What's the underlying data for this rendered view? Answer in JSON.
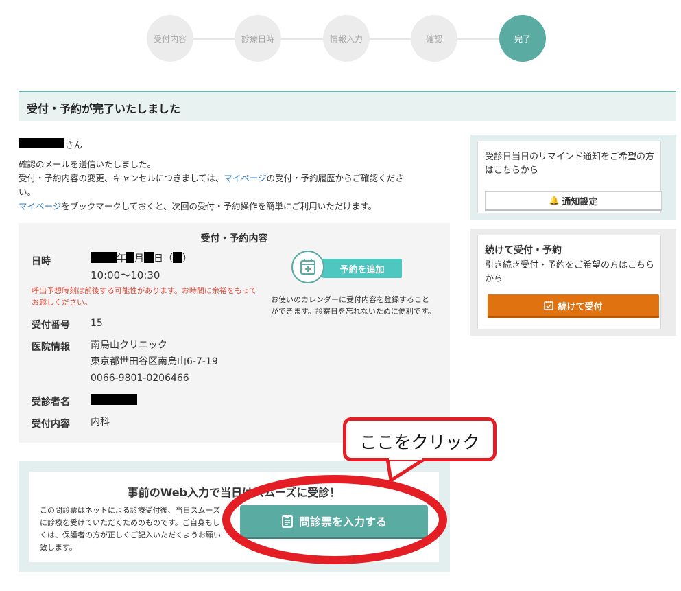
{
  "stepper": {
    "steps": [
      "受付内容",
      "診療日時",
      "情報入力",
      "確認",
      "完了"
    ]
  },
  "page_title": "受付・予約が完了いたしました",
  "intro": {
    "name_suffix": "さん",
    "line1": "確認のメールを送信いたしました。",
    "line2_a": "受付・予約内容の変更、キャンセルにつきましては、",
    "mypage_link": "マイページ",
    "line2_b": "の受付・予約履歴からご確認くださ",
    "line3": "い。",
    "line4_b": "をブックマークしておくと、次回の受付・予約操作を簡単にご利用いただけます。"
  },
  "details": {
    "title": "受付・予約内容",
    "datetime_label": "日時",
    "date_year": "年",
    "date_month": "月",
    "date_day": "日（",
    "date_close": "）",
    "time": "10:00〜10:30",
    "warning": "呼出予想時刻は前後する可能性があります。お時間に余裕をもってお越しください。",
    "number_label": "受付番号",
    "number": "15",
    "clinic_label": "医院情報",
    "clinic_name": "南烏山クリニック",
    "clinic_address": "東京都世田谷区南烏山6-7-19",
    "clinic_phone": "0066-9801-0206466",
    "patient_label": "受診者名",
    "content_label": "受付内容",
    "content": "内科",
    "add_calendar_label": "予約を追加",
    "calendar_desc": "お使いのカレンダーに受付内容を登録することができます。診察日を忘れないために便利です。"
  },
  "web_input": {
    "title": "事前のWeb入力で当日はスムーズに受診！",
    "desc": "この問診票はネットによる診療受付後、当日スムーズに診療を受けていただくためのものです。ご自身もしくは、保護者の方が正しくご記入いただくようお願い致します。",
    "button_label": "問診票を入力する"
  },
  "reminder": {
    "text": "受診日当日のリマインド通知をご希望の方はこちらから",
    "button_label": "通知設定"
  },
  "continue": {
    "title": "続けて受付・予約",
    "text": "引き続き受付・予約をご希望の方はこちらから",
    "button_label": "続けて受付"
  },
  "annotation": {
    "callout_text": "ここをクリック"
  },
  "colors": {
    "accent": "#5aaba1",
    "orange": "#e07310",
    "annotation_red": "#e31e24",
    "link": "#2b7bc4",
    "warning": "#e04a3a"
  }
}
